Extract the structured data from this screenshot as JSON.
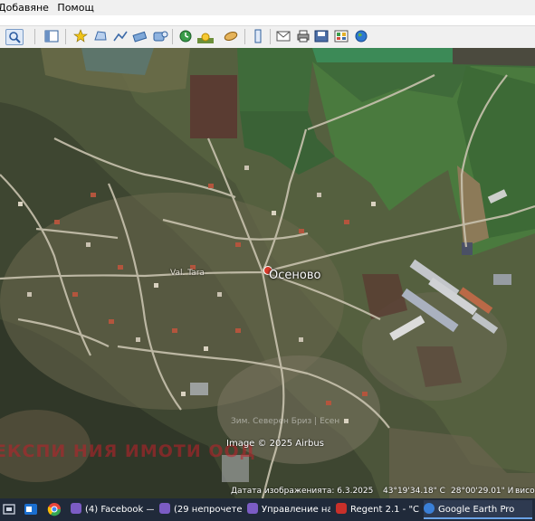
{
  "menu": {
    "items": [
      "Добавяне",
      "Помощ"
    ]
  },
  "toolbar": {
    "icons": [
      "search-icon",
      "sidebar-icon",
      "placemark-icon",
      "polygon-icon",
      "path-icon",
      "overlay-icon",
      "tour-icon",
      "history-icon",
      "sun-icon",
      "planets-icon",
      "ruler-icon",
      "email-icon",
      "print-icon",
      "save-image-icon",
      "maps-icon",
      "earth-icon"
    ]
  },
  "map": {
    "place_label": "Осеново",
    "street_label": "Val. Tara",
    "watermark": "ЕКСПИ НИЯ ИМОТИ ООД",
    "faded_text": "Зим. Северен Бриз | Есен",
    "copyright": "Image © 2025 Airbus",
    "status": {
      "imagery_date": "Датата изображенията: 6.3.2025",
      "latitude": "43°19'34.18\" С",
      "longitude": "28°00'29.01\" И",
      "altitude_label": "висо"
    }
  },
  "taskbar": {
    "apps": [
      {
        "label": "(4) Facebook —",
        "icon": "browser-icon"
      },
      {
        "label": "(29 непрочетен",
        "icon": "browser-icon"
      },
      {
        "label": "Управление на",
        "icon": "browser-icon"
      },
      {
        "label": "Regent 2.1 - \"CE",
        "icon": "regent-icon"
      },
      {
        "label": "Google Earth Pro",
        "icon": "google-earth-icon"
      }
    ]
  }
}
